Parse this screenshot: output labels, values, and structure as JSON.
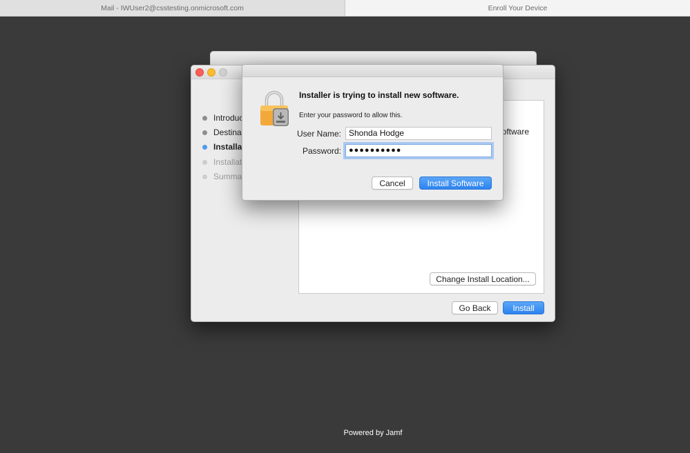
{
  "browser": {
    "tabs": [
      {
        "label": "Mail - IWUser2@csstesting.onmicrosoft.com"
      },
      {
        "label": "Enroll Your Device"
      }
    ]
  },
  "installer": {
    "steps": [
      {
        "label": "Introduction",
        "state": "done"
      },
      {
        "label": "Destination Select",
        "state": "done"
      },
      {
        "label": "Installation Type",
        "state": "active"
      },
      {
        "label": "Installation",
        "state": "pending"
      },
      {
        "label": "Summary",
        "state": "pending"
      }
    ],
    "partial_text": "oftware",
    "change_location_label": "Change Install Location...",
    "go_back_label": "Go Back",
    "install_label": "Install"
  },
  "auth_dialog": {
    "title": "Installer is trying to install new software.",
    "subtitle": "Enter your password to allow this.",
    "username_label": "User Name:",
    "username_value": "Shonda Hodge",
    "password_label": "Password:",
    "password_masked": "●●●●●●●●●●",
    "cancel_label": "Cancel",
    "install_software_label": "Install Software"
  },
  "footer": {
    "powered_by": "Powered by Jamf"
  },
  "colors": {
    "background": "#3a3a3a",
    "accent": "#2d83ee",
    "close": "#fc5f57",
    "minimize": "#fdbc2e"
  }
}
